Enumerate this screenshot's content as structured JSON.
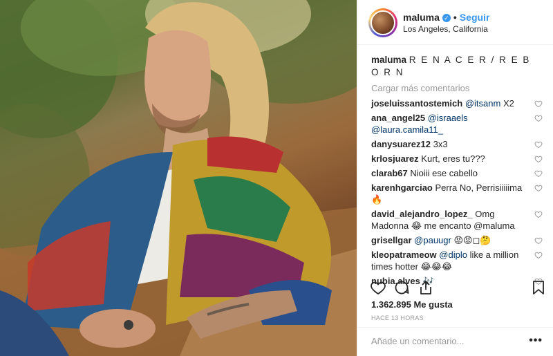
{
  "header": {
    "username": "maluma",
    "follow_label": "Seguir",
    "location": "Los Angeles, California",
    "verified_mark": "✓"
  },
  "caption": {
    "username": "maluma",
    "text": "R E N A C E R / R E B O R N"
  },
  "load_more_label": "Cargar más comentarios",
  "comments": [
    {
      "user": "joseluissantostemich",
      "mention": "@itsanm",
      "text": " X2"
    },
    {
      "user": "ana_angel25",
      "mention": "@israaels @laura.camila11_",
      "text": ""
    },
    {
      "user": "danysuarez12",
      "mention": "",
      "text": "3x3"
    },
    {
      "user": "krlosjuarez",
      "mention": "",
      "text": "Kurt, eres tu???"
    },
    {
      "user": "clarab67",
      "mention": "",
      "text": "Nioiii ese cabello"
    },
    {
      "user": "karenhgarciao",
      "mention": "",
      "text": "Perra No, Perrisiiiiima 🔥"
    },
    {
      "user": "david_alejandro_lopez_",
      "mention": "",
      "text": "Omg Madonna 😂 me encanto @maluma"
    },
    {
      "user": "grisellgar",
      "mention": "@pauugr",
      "text": " 😡😡◻🤔"
    },
    {
      "user": "kleopatrameow",
      "mention": "@diplo",
      "text": " like a million times hotter 😂😂😂"
    },
    {
      "user": "nubia.alves",
      "mention": "",
      "text": "🎶"
    }
  ],
  "likes_label": "1.362.895 Me gusta",
  "time_label": "HACE 13 HORAS",
  "add_comment_placeholder": "Añade un comentario...",
  "more_label": "•••",
  "icons": {
    "like": "heart-icon",
    "comment": "comment-icon",
    "share": "share-icon",
    "save": "bookmark-icon"
  },
  "colors": {
    "accent": "#3897f0",
    "muted": "#999999",
    "text": "#262626"
  }
}
